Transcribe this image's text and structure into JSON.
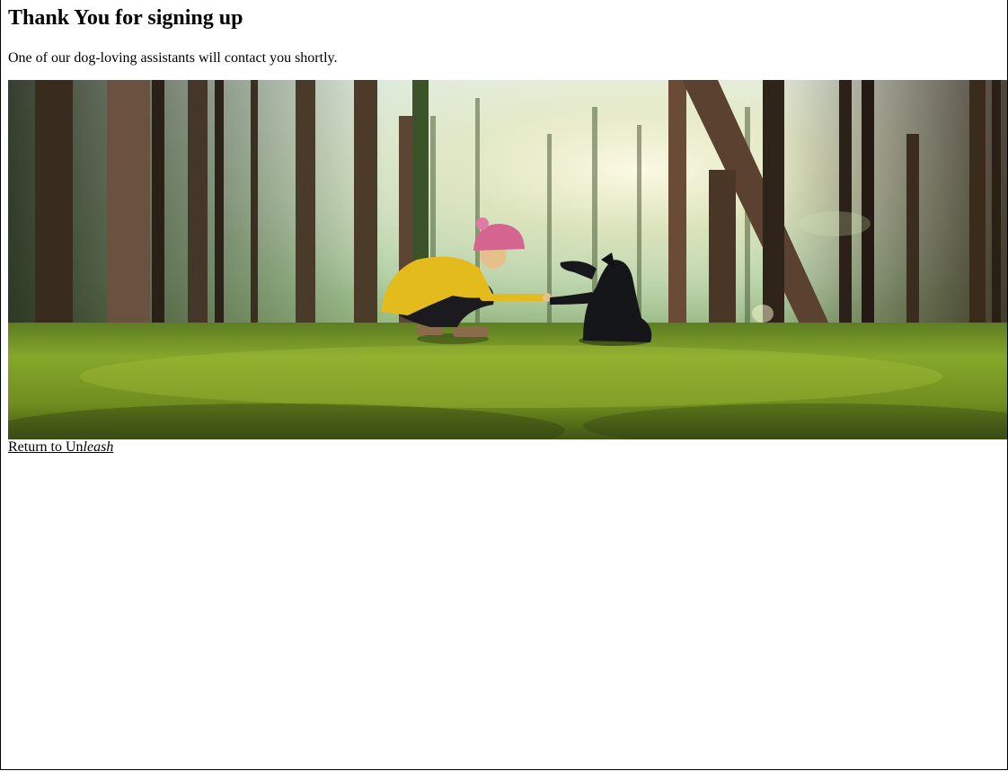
{
  "page": {
    "heading": "Thank You for signing up",
    "message": "One of our dog-loving assistants will contact you shortly."
  },
  "hero": {
    "alt": "Person in a yellow coat and pink beanie shaking paws with a black dog in a sunlit forest"
  },
  "return_link": {
    "prefix": "Return to Un",
    "emphasis": "leash"
  }
}
